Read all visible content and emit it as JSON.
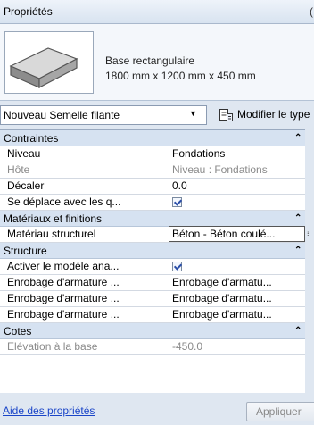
{
  "window": {
    "title": "Propriétés",
    "title_right": "("
  },
  "type_preview": {
    "line1": "Base rectangulaire",
    "line2": "1800 mm x 1200 mm x 450 mm",
    "thumbnail_icon": "rectangular-footing-3d-icon"
  },
  "selector": {
    "instance_label": "Nouveau Semelle filante",
    "dropdown_icon": "chevron-down-icon",
    "edit_type_icon": "edit-type-icon",
    "edit_type_label": "Modifier le type"
  },
  "sections": [
    {
      "name": "Contraintes",
      "collapse_glyph": "⌃",
      "rows": [
        {
          "key": "Niveau",
          "value": "Fondations",
          "disabled": false
        },
        {
          "key": "Hôte",
          "value": "Niveau : Fondations",
          "disabled": true
        },
        {
          "key": "Décaler",
          "value": "0.0",
          "disabled": false
        },
        {
          "key": "Se déplace avec les q...",
          "value": "",
          "checkbox": true,
          "checked": true
        }
      ]
    },
    {
      "name": "Matériaux et finitions",
      "collapse_glyph": "⌃",
      "rows": [
        {
          "key": "Matériau structurel",
          "value": "Béton - Béton coulé...",
          "editing": true
        }
      ]
    },
    {
      "name": "Structure",
      "collapse_glyph": "⌃",
      "rows": [
        {
          "key": "Activer le modèle ana...",
          "value": "",
          "checkbox": true,
          "checked": true
        },
        {
          "key": "Enrobage d'armature ...",
          "value": "Enrobage d'armatu..."
        },
        {
          "key": "Enrobage d'armature ...",
          "value": "Enrobage d'armatu..."
        },
        {
          "key": "Enrobage d'armature ...",
          "value": "Enrobage d'armatu..."
        }
      ]
    },
    {
      "name": "Cotes",
      "collapse_glyph": "⌃",
      "rows": [
        {
          "key": "Elévation à la base",
          "value": "-450.0",
          "disabled": true
        }
      ]
    }
  ],
  "footer": {
    "help_link": "Aide des propriétés",
    "apply_label": "Appliquer"
  }
}
